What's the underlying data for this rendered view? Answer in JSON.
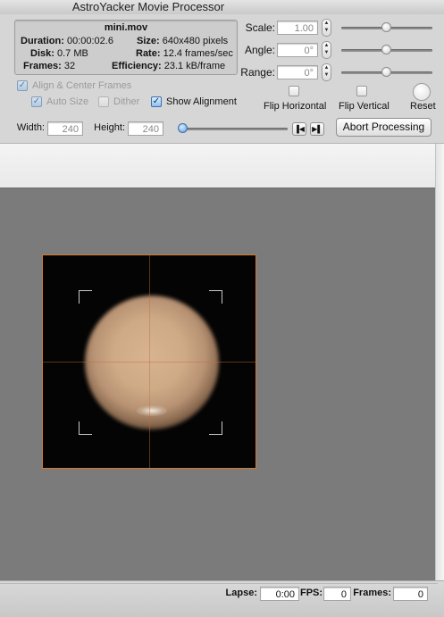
{
  "window": {
    "title": "AstroYacker Movie Processor"
  },
  "info": {
    "filename": "mini.mov",
    "duration_label": "Duration:",
    "duration": "00:00:02.6",
    "disk_label": "Disk:",
    "disk": "0.7 MB",
    "frames_label": "Frames:",
    "frames": "32",
    "size_label": "Size:",
    "size": "640x480 pixels",
    "rate_label": "Rate:",
    "rate": "12.4 frames/sec",
    "efficiency_label": "Efficiency:",
    "efficiency": "23.1 kB/frame"
  },
  "transform": {
    "scale_label": "Scale:",
    "scale_value": "1.00",
    "angle_label": "Angle:",
    "angle_value": "0°",
    "range_label": "Range:",
    "range_value": "0°",
    "flip_horizontal_label": "Flip Horizontal",
    "flip_vertical_label": "Flip Vertical",
    "reset_label": "Reset"
  },
  "options": {
    "align_center_label": "Align & Center Frames",
    "auto_size_label": "Auto Size",
    "dither_label": "Dither",
    "show_alignment_label": "Show Alignment",
    "align_center_checked": true,
    "auto_size_checked": true,
    "dither_checked": false,
    "show_alignment_checked": true
  },
  "dimensions": {
    "width_label": "Width:",
    "width_value": "240",
    "height_label": "Height:",
    "height_value": "240"
  },
  "playback": {
    "position": 0,
    "abort_label": "Abort Processing"
  },
  "status": {
    "lapse_label": "Lapse:",
    "lapse_value": "0:00",
    "fps_label": "FPS:",
    "fps_value": "0",
    "frames_label": "Frames:",
    "frames_value": "0"
  },
  "colors": {
    "frame_border": "#d4782b",
    "accent": "#5b9be0"
  }
}
